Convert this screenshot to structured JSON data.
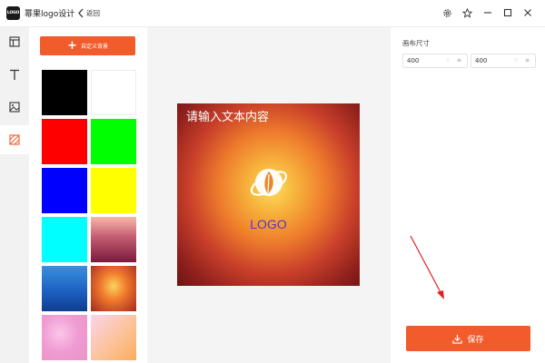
{
  "app": {
    "logo_badge": "LOGO",
    "title": "幂果logo设计",
    "back_label": "返回",
    "window_controls": [
      "settings-icon",
      "star-icon",
      "minimize-icon",
      "maximize-icon",
      "close-icon"
    ]
  },
  "rail": {
    "items": [
      {
        "icon": "layout-icon",
        "active": false
      },
      {
        "icon": "text-icon",
        "active": false
      },
      {
        "icon": "image-icon",
        "active": false
      },
      {
        "icon": "background-icon",
        "active": true
      }
    ]
  },
  "background_panel": {
    "custom_button_label": "自定义背景",
    "swatches": [
      {
        "color": "#000000"
      },
      {
        "color": "#ffffff"
      },
      {
        "color": "#ff0000"
      },
      {
        "color": "#00ff00"
      },
      {
        "color": "#0000ff"
      },
      {
        "color": "#ffff00"
      },
      {
        "color": "#00ffff"
      },
      {
        "gradient": "linear-gradient(180deg,#f7b9a7 0%,#c35b72 45%,#7a1a3c 100%)"
      },
      {
        "gradient": "linear-gradient(180deg,#3a8fde 0%,#1c5dbe 60%,#0f3d8e 100%)"
      },
      {
        "gradient": "radial-gradient(ellipse at 50% 45%,#fbd45c 0%,#f07a2d 40%,#a5281f 100%)"
      },
      {
        "gradient": "radial-gradient(ellipse at 40% 40%,#fbc6e8 0%,#f09ad2 50%,#e996c4 100%)"
      },
      {
        "gradient": "linear-gradient(135deg,#fbd4ea 0%,#fcc39a 55%,#f9ad5c 100%)"
      }
    ]
  },
  "canvas": {
    "text": "请输入文本内容",
    "logo_text": "LOGO"
  },
  "properties": {
    "title": "画布尺寸",
    "width_value": "400",
    "height_value": "400",
    "save_label": "保存"
  }
}
